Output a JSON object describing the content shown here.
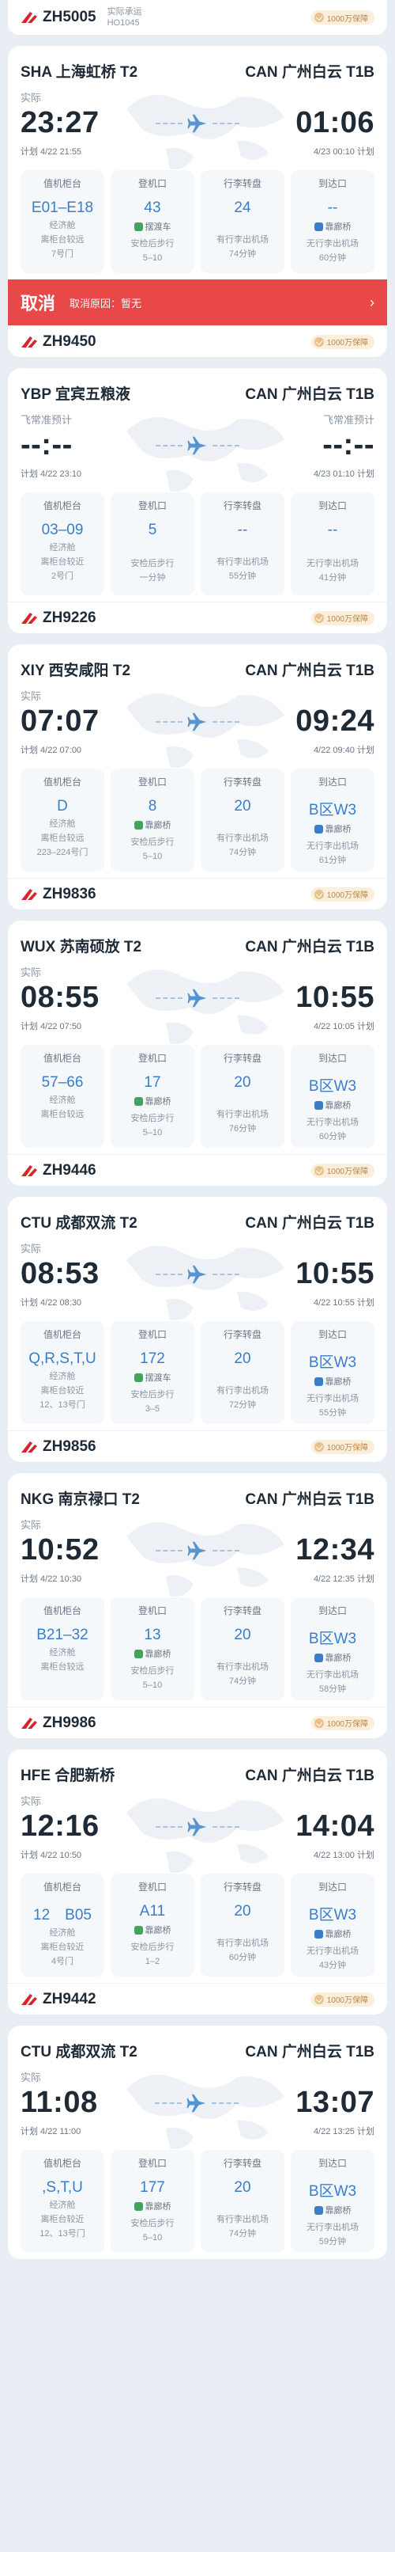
{
  "top": {
    "flight": "ZH5005",
    "extra1": "实际承运",
    "extra2": "HO1045",
    "insurance": "1000万保障"
  },
  "cards": [
    {
      "from": "SHA 上海虹桥 T2",
      "to": "CAN 广州白云 T1B",
      "dep_status": "实际",
      "arr_status": "",
      "dep_time": "23:27",
      "arr_time": "01:06",
      "dep_plan": "计划 4/22 21:55",
      "arr_plan": "4/23 00:10 计划",
      "c1": {
        "lbl": "值机柜台",
        "val": "E01–E18",
        "s1": "经济舱",
        "s2": "离柜台较远",
        "s3": "7号门"
      },
      "c2": {
        "lbl": "登机口",
        "val": "43",
        "tag": "摆渡车",
        "s2": "安检后步行",
        "s3": "5–10"
      },
      "c3": {
        "lbl": "行李转盘",
        "val": "24",
        "s2": "有行李出机场",
        "s3": "74分钟"
      },
      "c4": {
        "lbl": "到达口",
        "val": "--",
        "tag": "靠廊桥",
        "s2": "无行李出机场",
        "s3": "60分钟"
      },
      "cancel": {
        "big": "取消",
        "small": "取消原因：暂无",
        "chev": "›"
      },
      "flight": "ZH9450",
      "insurance": "1000万保障"
    },
    {
      "from": "YBP 宜宾五粮液",
      "to": "CAN 广州白云 T1B",
      "dep_status": "飞常准预计",
      "arr_status": "飞常准预计",
      "dep_time": "--:--",
      "arr_time": "--:--",
      "dep_plan": "计划 4/22 23:10",
      "arr_plan": "4/23 01:10 计划",
      "c1": {
        "lbl": "值机柜台",
        "val": "03–09",
        "s1": "经济舱",
        "s2": "离柜台较近",
        "s3": "2号门"
      },
      "c2": {
        "lbl": "登机口",
        "val": "5",
        "tag": "",
        "s2": "安检后步行",
        "s3": "一分钟"
      },
      "c3": {
        "lbl": "行李转盘",
        "val": "--",
        "s2": "有行李出机场",
        "s3": "55分钟"
      },
      "c4": {
        "lbl": "到达口",
        "val": "--",
        "tag": "",
        "s2": "无行李出机场",
        "s3": "41分钟"
      },
      "flight": "ZH9226",
      "insurance": "1000万保障"
    },
    {
      "from": "XIY 西安咸阳 T2",
      "to": "CAN 广州白云 T1B",
      "dep_status": "实际",
      "arr_status": "",
      "dep_time": "07:07",
      "arr_time": "09:24",
      "dep_plan": "计划 4/22 07:00",
      "arr_plan": "4/22 09:40 计划",
      "c1": {
        "lbl": "值机柜台",
        "val": "D",
        "s1": "经济舱",
        "s2": "离柜台较远",
        "s3": "223–224号门"
      },
      "c2": {
        "lbl": "登机口",
        "val": "8",
        "tag": "靠廊桥",
        "s2": "安检后步行",
        "s3": "5–10"
      },
      "c3": {
        "lbl": "行李转盘",
        "val": "20",
        "s2": "有行李出机场",
        "s3": "74分钟"
      },
      "c4": {
        "lbl": "到达口",
        "val": "B区W3",
        "tag": "靠廊桥",
        "s2": "无行李出机场",
        "s3": "61分钟"
      },
      "flight": "ZH9836",
      "insurance": "1000万保障"
    },
    {
      "from": "WUX 苏南硕放 T2",
      "to": "CAN 广州白云 T1B",
      "dep_status": "实际",
      "arr_status": "",
      "dep_time": "08:55",
      "arr_time": "10:55",
      "dep_plan": "计划 4/22 07:50",
      "arr_plan": "4/22 10:05 计划",
      "c1": {
        "lbl": "值机柜台",
        "val": "57–66",
        "s1": "经济舱",
        "s2": "离柜台较远",
        "s3": ""
      },
      "c2": {
        "lbl": "登机口",
        "val": "17",
        "tag": "靠廊桥",
        "s2": "安检后步行",
        "s3": "5–10"
      },
      "c3": {
        "lbl": "行李转盘",
        "val": "20",
        "s2": "有行李出机场",
        "s3": "76分钟"
      },
      "c4": {
        "lbl": "到达口",
        "val": "B区W3",
        "tag": "靠廊桥",
        "s2": "无行李出机场",
        "s3": "60分钟"
      },
      "flight": "ZH9446",
      "insurance": "1000万保障"
    },
    {
      "from": "CTU 成都双流 T2",
      "to": "CAN 广州白云 T1B",
      "dep_status": "实际",
      "arr_status": "",
      "dep_time": "08:53",
      "arr_time": "10:55",
      "dep_plan": "计划 4/22 08:30",
      "arr_plan": "4/22 10:55 计划",
      "c1": {
        "lbl": "值机柜台",
        "val": "Q,R,S,T,U",
        "s1": "经济舱",
        "s2": "离柜台较近",
        "s3": "12、13号门"
      },
      "c2": {
        "lbl": "登机口",
        "val": "172",
        "tag": "摆渡车",
        "s2": "安检后步行",
        "s3": "3–5"
      },
      "c3": {
        "lbl": "行李转盘",
        "val": "20",
        "s2": "有行李出机场",
        "s3": "72分钟"
      },
      "c4": {
        "lbl": "到达口",
        "val": "B区W3",
        "tag": "靠廊桥",
        "s2": "无行李出机场",
        "s3": "55分钟"
      },
      "flight": "ZH9856",
      "insurance": "1000万保障"
    },
    {
      "from": "NKG 南京禄口 T2",
      "to": "CAN 广州白云 T1B",
      "dep_status": "实际",
      "arr_status": "",
      "dep_time": "10:52",
      "arr_time": "12:34",
      "dep_plan": "计划 4/22 10:30",
      "arr_plan": "4/22 12:35 计划",
      "c1": {
        "lbl": "值机柜台",
        "val": "B21–32",
        "s1": "经济舱",
        "s2": "离柜台较远",
        "s3": ""
      },
      "c2": {
        "lbl": "登机口",
        "val": "13",
        "tag": "靠廊桥",
        "s2": "安检后步行",
        "s3": "5–10"
      },
      "c3": {
        "lbl": "行李转盘",
        "val": "20",
        "s2": "有行李出机场",
        "s3": "74分钟"
      },
      "c4": {
        "lbl": "到达口",
        "val": "B区W3",
        "tag": "靠廊桥",
        "s2": "无行李出机场",
        "s3": "58分钟"
      },
      "flight": "ZH9986",
      "insurance": "1000万保障"
    },
    {
      "from": "HFE 合肥新桥",
      "to": "CAN 广州白云 T1B",
      "dep_status": "实际",
      "arr_status": "",
      "dep_time": "12:16",
      "arr_time": "14:04",
      "dep_plan": "计划 4/22 10:50",
      "arr_plan": "4/22 13:00 计划",
      "c1": {
        "lbl": "值机柜台",
        "val": "12　B05",
        "s1": "经济舱",
        "s2": "离柜台较近",
        "s3": "4号门"
      },
      "c2": {
        "lbl": "登机口",
        "val": "A11",
        "tag": "靠廊桥",
        "s2": "安检后步行",
        "s3": "1–2"
      },
      "c3": {
        "lbl": "行李转盘",
        "val": "20",
        "s2": "有行李出机场",
        "s3": "60分钟"
      },
      "c4": {
        "lbl": "到达口",
        "val": "B区W3",
        "tag": "靠廊桥",
        "s2": "无行李出机场",
        "s3": "43分钟"
      },
      "flight": "ZH9442",
      "insurance": "1000万保障"
    },
    {
      "from": "CTU 成都双流 T2",
      "to": "CAN 广州白云 T1B",
      "dep_status": "实际",
      "arr_status": "",
      "dep_time": "11:08",
      "arr_time": "13:07",
      "dep_plan": "计划 4/22 11:00",
      "arr_plan": "4/22 13:25 计划",
      "c1": {
        "lbl": "值机柜台",
        "val": ",S,T,U",
        "s1": "经济舱",
        "s2": "离柜台较近",
        "s3": "12、13号门"
      },
      "c2": {
        "lbl": "登机口",
        "val": "177",
        "tag": "靠廊桥",
        "s2": "安检后步行",
        "s3": "5–10"
      },
      "c3": {
        "lbl": "行李转盘",
        "val": "20",
        "s2": "有行李出机场",
        "s3": "74分钟"
      },
      "c4": {
        "lbl": "到达口",
        "val": "B区W3",
        "tag": "靠廊桥",
        "s2": "无行李出机场",
        "s3": "59分钟"
      },
      "flight": "",
      "insurance": ""
    }
  ]
}
